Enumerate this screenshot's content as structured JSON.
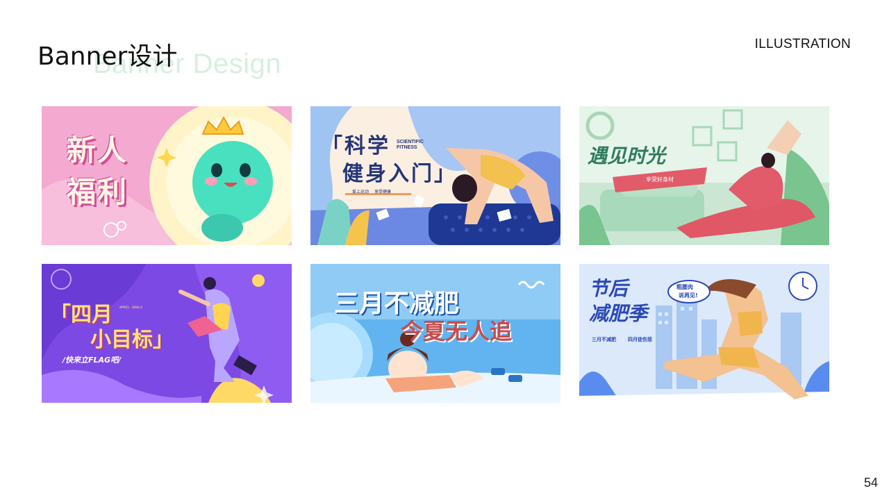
{
  "header": {
    "title": "Banner设计",
    "title_bg": "Banner Design",
    "section": "ILLUSTRATION"
  },
  "page_number": "54",
  "banners": [
    {
      "line1": "新人",
      "line2": "福利",
      "accent": "#f4a9d0"
    },
    {
      "line1": "「科学",
      "line2": "健身入门」",
      "sub": "SCIENTIFIC FITNESS",
      "tag1": "爱上运动",
      "tag2": "享受健康",
      "accent": "#5b7fe0"
    },
    {
      "title": "遇见时光",
      "ribbon": "享受好身材",
      "accent": "#dcefe2"
    },
    {
      "line1": "「四月",
      "line2": "小目标」",
      "tag": "APRIL GOALS",
      "sub": "/快来立FLAG吧/",
      "accent": "#7d49e4"
    },
    {
      "line1": "三月不减肥",
      "line2": "今夏无人追",
      "accent": "#61b4ef"
    },
    {
      "line1": "节后",
      "line2": "减肥季",
      "bubble1": "粗腰肉",
      "bubble2": "说再见!",
      "sub1": "三月不减肥",
      "sub2": "四月徒伤悲",
      "accent": "#dbe9fb"
    }
  ]
}
